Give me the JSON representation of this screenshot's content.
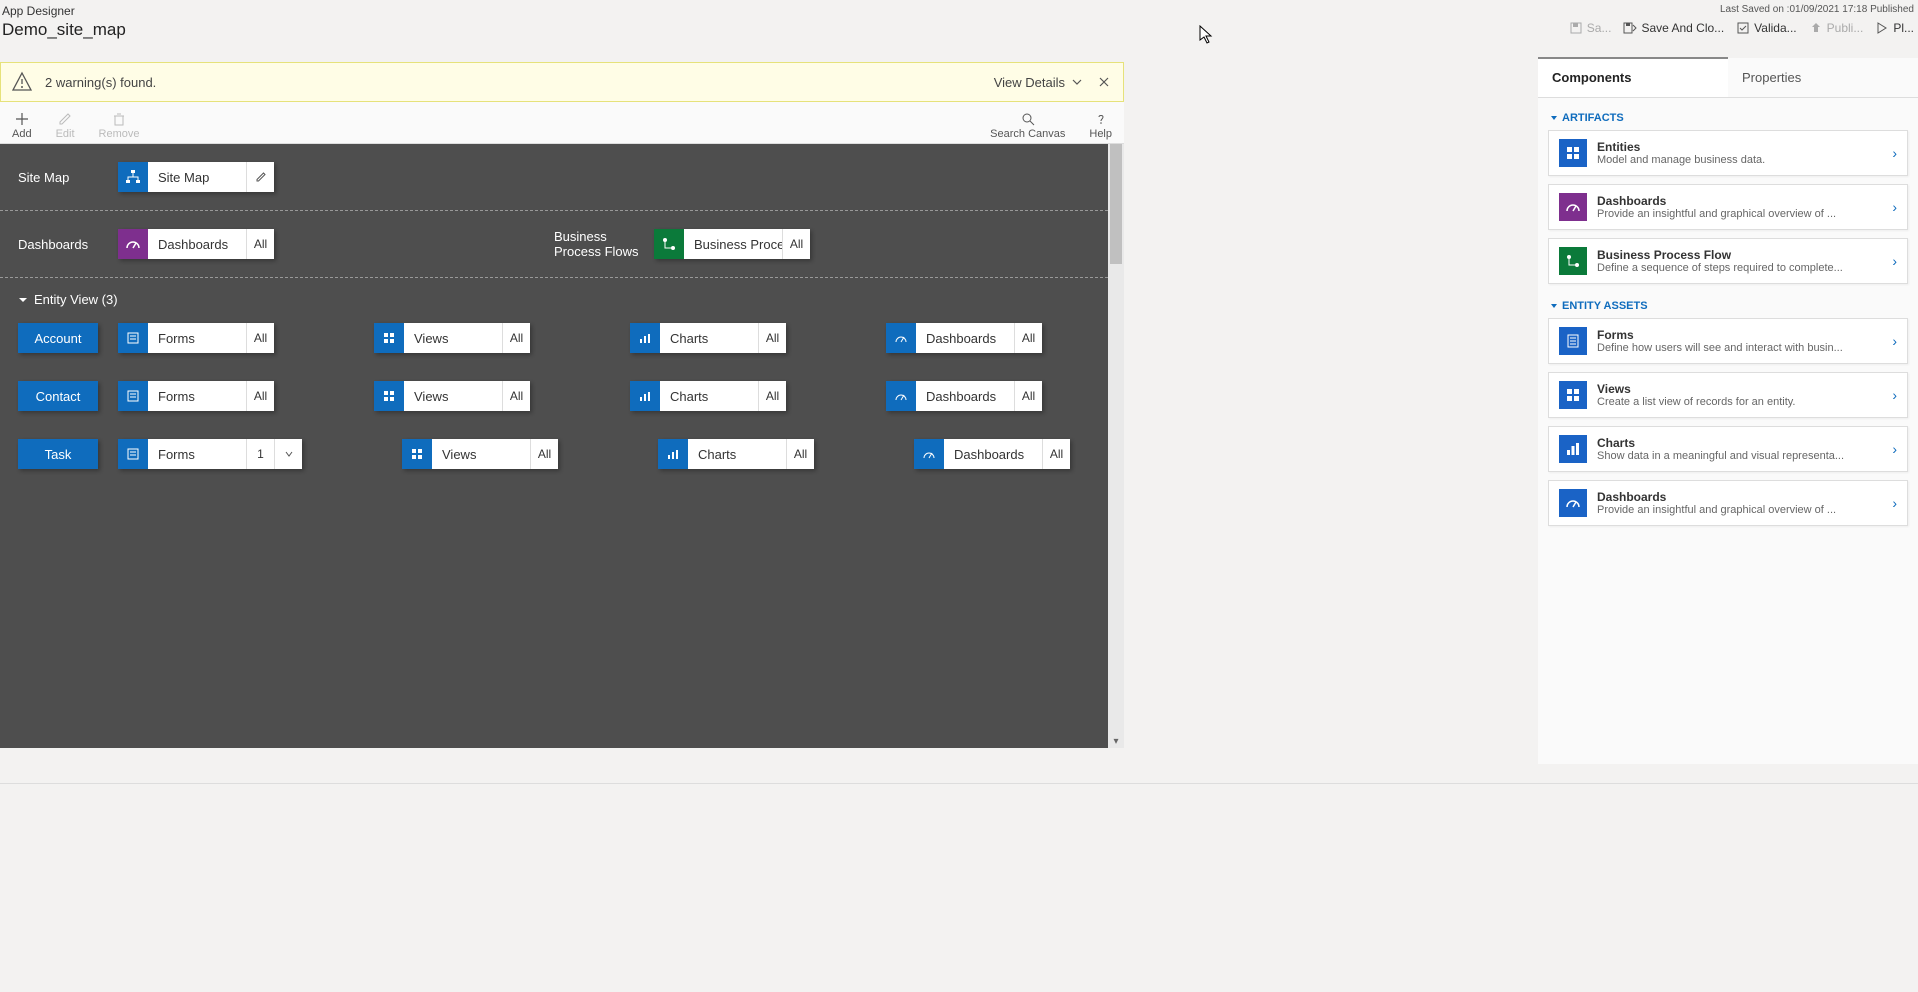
{
  "header": {
    "app_title": "App Designer",
    "app_name": "Demo_site_map",
    "last_saved": "Last Saved on :01/09/2021 17:18 Published",
    "buttons": {
      "save": "Sa...",
      "save_close": "Save And Clo...",
      "validate": "Valida...",
      "publish": "Publi...",
      "play": "Pl..."
    }
  },
  "warning": {
    "text": "2 warning(s) found.",
    "details": "View Details"
  },
  "toolbar": {
    "add": "Add",
    "edit": "Edit",
    "remove": "Remove",
    "search": "Search Canvas",
    "help": "Help"
  },
  "canvas": {
    "sitemap_label": "Site Map",
    "sitemap_tile": "Site Map",
    "dashboards_label": "Dashboards",
    "dashboards_tile": "Dashboards",
    "bpf_label": "Business Process Flows",
    "bpf_tile": "Business Proces...",
    "all": "All",
    "entity_header": "Entity View (3)",
    "entities": [
      {
        "name": "Account",
        "forms": "Forms",
        "forms_count": "All",
        "views": "Views",
        "views_count": "All",
        "charts": "Charts",
        "charts_count": "All",
        "dash": "Dashboards",
        "dash_count": "All"
      },
      {
        "name": "Contact",
        "forms": "Forms",
        "forms_count": "All",
        "views": "Views",
        "views_count": "All",
        "charts": "Charts",
        "charts_count": "All",
        "dash": "Dashboards",
        "dash_count": "All"
      },
      {
        "name": "Task",
        "forms": "Forms",
        "forms_count": "1",
        "views": "Views",
        "views_count": "All",
        "charts": "Charts",
        "charts_count": "All",
        "dash": "Dashboards",
        "dash_count": "All"
      }
    ]
  },
  "panel": {
    "tab_components": "Components",
    "tab_properties": "Properties",
    "groups": {
      "artifacts": "ARTIFACTS",
      "entity_assets": "ENTITY ASSETS"
    },
    "artifacts": [
      {
        "title": "Entities",
        "desc": "Model and manage business data.",
        "color": "ci-blue",
        "icon": "grid"
      },
      {
        "title": "Dashboards",
        "desc": "Provide an insightful and graphical overview of ...",
        "color": "ci-purple",
        "icon": "gauge"
      },
      {
        "title": "Business Process Flow",
        "desc": "Define a sequence of steps required to complete...",
        "color": "ci-green",
        "icon": "flow"
      }
    ],
    "assets": [
      {
        "title": "Forms",
        "desc": "Define how users will see and interact with busin...",
        "color": "ci-blue",
        "icon": "form"
      },
      {
        "title": "Views",
        "desc": "Create a list view of records for an entity.",
        "color": "ci-blue",
        "icon": "grid"
      },
      {
        "title": "Charts",
        "desc": "Show data in a meaningful and visual representa...",
        "color": "ci-blue",
        "icon": "chart"
      },
      {
        "title": "Dashboards",
        "desc": "Provide an insightful and graphical overview of ...",
        "color": "ci-blue",
        "icon": "gauge"
      }
    ]
  }
}
